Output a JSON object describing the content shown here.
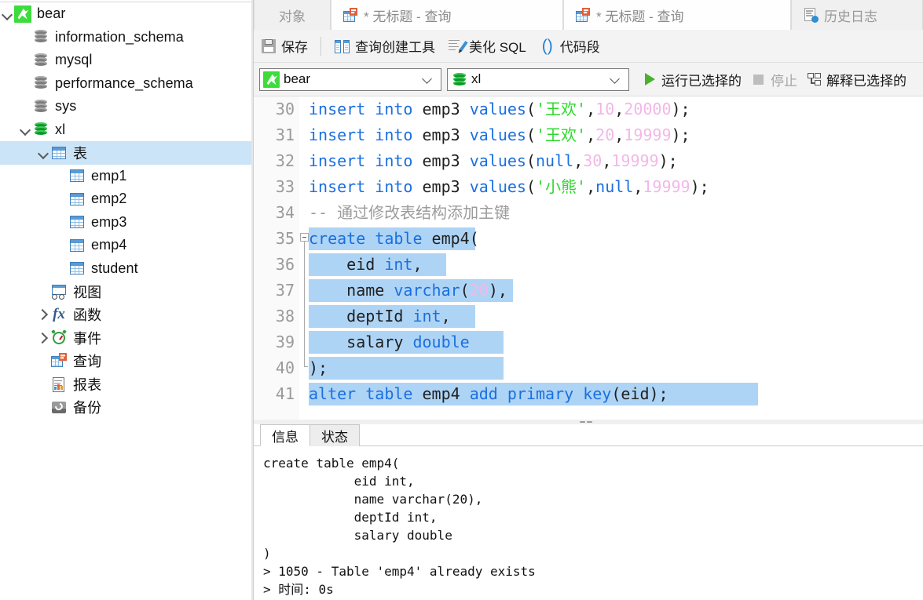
{
  "sidebar": {
    "nodes": [
      {
        "label": "bear",
        "icon": "connection-icon",
        "indent": 0,
        "twist": "open",
        "selected": false
      },
      {
        "label": "information_schema",
        "icon": "database-grey-icon",
        "indent": 1,
        "twist": "none",
        "selected": false
      },
      {
        "label": "mysql",
        "icon": "database-grey-icon",
        "indent": 1,
        "twist": "none",
        "selected": false
      },
      {
        "label": "performance_schema",
        "icon": "database-grey-icon",
        "indent": 1,
        "twist": "none",
        "selected": false
      },
      {
        "label": "sys",
        "icon": "database-grey-icon",
        "indent": 1,
        "twist": "none",
        "selected": false
      },
      {
        "label": "xl",
        "icon": "database-green-icon",
        "indent": 1,
        "twist": "open",
        "selected": false
      },
      {
        "label": "表",
        "icon": "table-icon",
        "indent": 2,
        "twist": "open",
        "selected": true
      },
      {
        "label": "emp1",
        "icon": "table-icon",
        "indent": 3,
        "twist": "none",
        "selected": false
      },
      {
        "label": "emp2",
        "icon": "table-icon",
        "indent": 3,
        "twist": "none",
        "selected": false
      },
      {
        "label": "emp3",
        "icon": "table-icon",
        "indent": 3,
        "twist": "none",
        "selected": false
      },
      {
        "label": "emp4",
        "icon": "table-icon",
        "indent": 3,
        "twist": "none",
        "selected": false
      },
      {
        "label": "student",
        "icon": "table-icon",
        "indent": 3,
        "twist": "none",
        "selected": false
      },
      {
        "label": "视图",
        "icon": "view-icon",
        "indent": 2,
        "twist": "none",
        "selected": false
      },
      {
        "label": "函数",
        "icon": "function-icon",
        "indent": 2,
        "twist": "closed",
        "selected": false
      },
      {
        "label": "事件",
        "icon": "event-clock-icon",
        "indent": 2,
        "twist": "closed",
        "selected": false
      },
      {
        "label": "查询",
        "icon": "query-icon",
        "indent": 2,
        "twist": "none",
        "selected": false
      },
      {
        "label": "报表",
        "icon": "report-icon",
        "indent": 2,
        "twist": "none",
        "selected": false
      },
      {
        "label": "备份",
        "icon": "backup-icon",
        "indent": 2,
        "twist": "none",
        "selected": false
      }
    ]
  },
  "tabs": [
    {
      "label": "对象",
      "icon": "none",
      "active": false
    },
    {
      "label": "* 无标题 - 查询",
      "icon": "query-icon",
      "active": true
    },
    {
      "label": "* 无标题 - 查询",
      "icon": "query-icon",
      "active": true
    },
    {
      "label": "历史日志",
      "icon": "history-log-icon",
      "active": false
    }
  ],
  "toolbar": {
    "save": "保存",
    "query_builder": "查询创建工具",
    "beautify_sql": "美化 SQL",
    "code_snippet": "代码段"
  },
  "toolbar2": {
    "connection": "bear",
    "database": "xl",
    "run_selected": "运行已选择的",
    "stop": "停止",
    "explain_selected": "解释已选择的"
  },
  "editor": {
    "lines": [
      {
        "n": "30",
        "tokens": [
          {
            "t": "insert into ",
            "c": "kw"
          },
          {
            "t": "emp3 ",
            "c": "pun"
          },
          {
            "t": "values",
            "c": "kw"
          },
          {
            "t": "(",
            "c": "pun"
          },
          {
            "t": "'王欢'",
            "c": "str"
          },
          {
            "t": ",",
            "c": "pun"
          },
          {
            "t": "10",
            "c": "num"
          },
          {
            "t": ",",
            "c": "pun"
          },
          {
            "t": "20000",
            "c": "num"
          },
          {
            "t": ");",
            "c": "pun"
          }
        ],
        "sel": false
      },
      {
        "n": "31",
        "tokens": [
          {
            "t": "insert into ",
            "c": "kw"
          },
          {
            "t": "emp3 ",
            "c": "pun"
          },
          {
            "t": "values",
            "c": "kw"
          },
          {
            "t": "(",
            "c": "pun"
          },
          {
            "t": "'王欢'",
            "c": "str"
          },
          {
            "t": ",",
            "c": "pun"
          },
          {
            "t": "20",
            "c": "num"
          },
          {
            "t": ",",
            "c": "pun"
          },
          {
            "t": "19999",
            "c": "num"
          },
          {
            "t": ");",
            "c": "pun"
          }
        ],
        "sel": false
      },
      {
        "n": "32",
        "tokens": [
          {
            "t": "insert into ",
            "c": "kw"
          },
          {
            "t": "emp3 ",
            "c": "pun"
          },
          {
            "t": "values",
            "c": "kw"
          },
          {
            "t": "(",
            "c": "pun"
          },
          {
            "t": "null",
            "c": "kw"
          },
          {
            "t": ",",
            "c": "pun"
          },
          {
            "t": "30",
            "c": "num"
          },
          {
            "t": ",",
            "c": "pun"
          },
          {
            "t": "19999",
            "c": "num"
          },
          {
            "t": ");",
            "c": "pun"
          }
        ],
        "sel": false
      },
      {
        "n": "33",
        "tokens": [
          {
            "t": "insert into ",
            "c": "kw"
          },
          {
            "t": "emp3 ",
            "c": "pun"
          },
          {
            "t": "values",
            "c": "kw"
          },
          {
            "t": "(",
            "c": "pun"
          },
          {
            "t": "'小熊'",
            "c": "str"
          },
          {
            "t": ",",
            "c": "pun"
          },
          {
            "t": "null",
            "c": "kw"
          },
          {
            "t": ",",
            "c": "pun"
          },
          {
            "t": "19999",
            "c": "num"
          },
          {
            "t": ");",
            "c": "pun"
          }
        ],
        "sel": false
      },
      {
        "n": "34",
        "tokens": [
          {
            "t": "-- 通过修改表结构添加主键",
            "c": "cmt"
          }
        ],
        "sel": false
      },
      {
        "n": "35",
        "tokens": [
          {
            "t": "create table ",
            "c": "kw"
          },
          {
            "t": "emp4(",
            "c": "pun"
          }
        ],
        "sel": true,
        "selw": 212,
        "fold": "start"
      },
      {
        "n": "36",
        "tokens": [
          {
            "t": "    eid ",
            "c": "pun"
          },
          {
            "t": "int",
            "c": "kw"
          },
          {
            "t": ",",
            "c": "pun"
          }
        ],
        "sel": true,
        "selw": 175,
        "fold": "mid"
      },
      {
        "n": "37",
        "tokens": [
          {
            "t": "    name ",
            "c": "pun"
          },
          {
            "t": "varchar",
            "c": "kw"
          },
          {
            "t": "(",
            "c": "pun"
          },
          {
            "t": "20",
            "c": "num"
          },
          {
            "t": "),",
            "c": "pun"
          }
        ],
        "sel": true,
        "selw": 260,
        "fold": "mid"
      },
      {
        "n": "38",
        "tokens": [
          {
            "t": "    deptId ",
            "c": "pun"
          },
          {
            "t": "int",
            "c": "kw"
          },
          {
            "t": ",",
            "c": "pun"
          }
        ],
        "sel": true,
        "selw": 212,
        "fold": "mid"
      },
      {
        "n": "39",
        "tokens": [
          {
            "t": "    salary ",
            "c": "pun"
          },
          {
            "t": "double",
            "c": "kw"
          }
        ],
        "sel": true,
        "selw": 248,
        "fold": "mid"
      },
      {
        "n": "40",
        "tokens": [
          {
            "t": ");",
            "c": "pun"
          }
        ],
        "sel": true,
        "selw": 248,
        "fold": "end"
      },
      {
        "n": "41",
        "tokens": [
          {
            "t": "alter table ",
            "c": "kw"
          },
          {
            "t": "emp4 ",
            "c": "pun"
          },
          {
            "t": "add primary key",
            "c": "kw"
          },
          {
            "t": "(eid);",
            "c": "pun"
          }
        ],
        "sel": true,
        "selw": 572,
        "fold": "none"
      }
    ]
  },
  "result": {
    "tabs": [
      {
        "label": "信息",
        "active": true
      },
      {
        "label": "状态",
        "active": false
      }
    ],
    "output": "create table emp4(\n            eid int,\n            name varchar(20),\n            deptId int,\n            salary double\n)\n> 1050 - Table 'emp4' already exists\n> 时间: 0s"
  },
  "colors": {
    "accent_green": "#3ddc3d",
    "keyword_blue": "#1a6fe0",
    "string_green": "#2bd92b",
    "number_pink": "#f3b7e8",
    "selection_blue": "#aed4f5",
    "tree_selection": "#cce4f7"
  }
}
